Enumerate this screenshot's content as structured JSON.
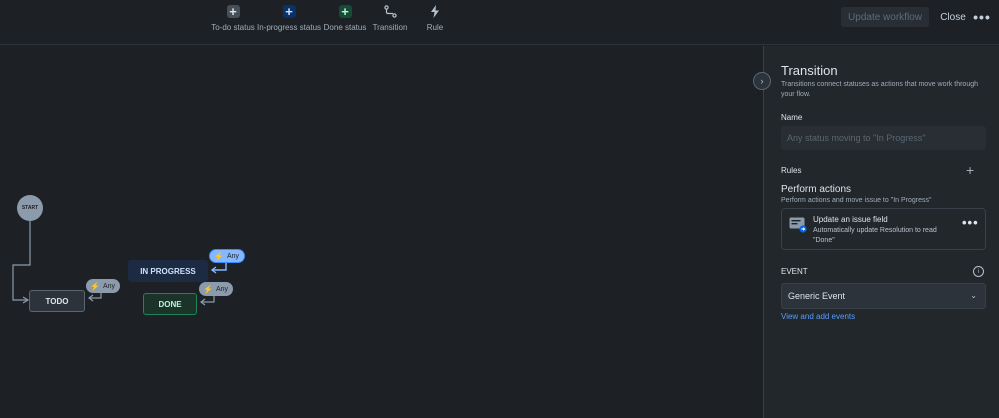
{
  "toolbar": {
    "items": [
      {
        "label": "To-do status",
        "icon": "plus-icon",
        "color": "#8c9bab"
      },
      {
        "label": "In-progress status",
        "icon": "plus-icon",
        "color": "#579dff"
      },
      {
        "label": "Done status",
        "icon": "plus-icon",
        "color": "#4bce97"
      },
      {
        "label": "Transition",
        "icon": "transition-icon",
        "color": "#b6c2cf"
      },
      {
        "label": "Rule",
        "icon": "lightning-icon",
        "color": "#b6c2cf"
      }
    ],
    "update_label": "Update workflow",
    "close_label": "Close",
    "more_label": "•••"
  },
  "canvas": {
    "start_label": "START",
    "statuses": {
      "todo": "TODO",
      "in_progress": "IN PROGRESS",
      "done": "DONE"
    },
    "any_label": "Any",
    "colors": {
      "todo": "#2c333a",
      "in_progress": "#1c2b41",
      "done": "#1c3329",
      "selected": "#85b8ff"
    }
  },
  "panel": {
    "title": "Transition",
    "description": "Transitions connect statuses as actions that move work through your flow.",
    "name_label": "Name",
    "name_placeholder": "Any status moving to \"In Progress\"",
    "rules_label": "Rules",
    "perform_title": "Perform actions",
    "perform_desc": "Perform actions and move issue to \"In Progress\"",
    "action": {
      "title": "Update an issue field",
      "description": "Automatically update Resolution to read \"Done\"",
      "more": "•••"
    },
    "event_label": "EVENT",
    "event_value": "Generic Event",
    "event_link": "View and add events"
  }
}
